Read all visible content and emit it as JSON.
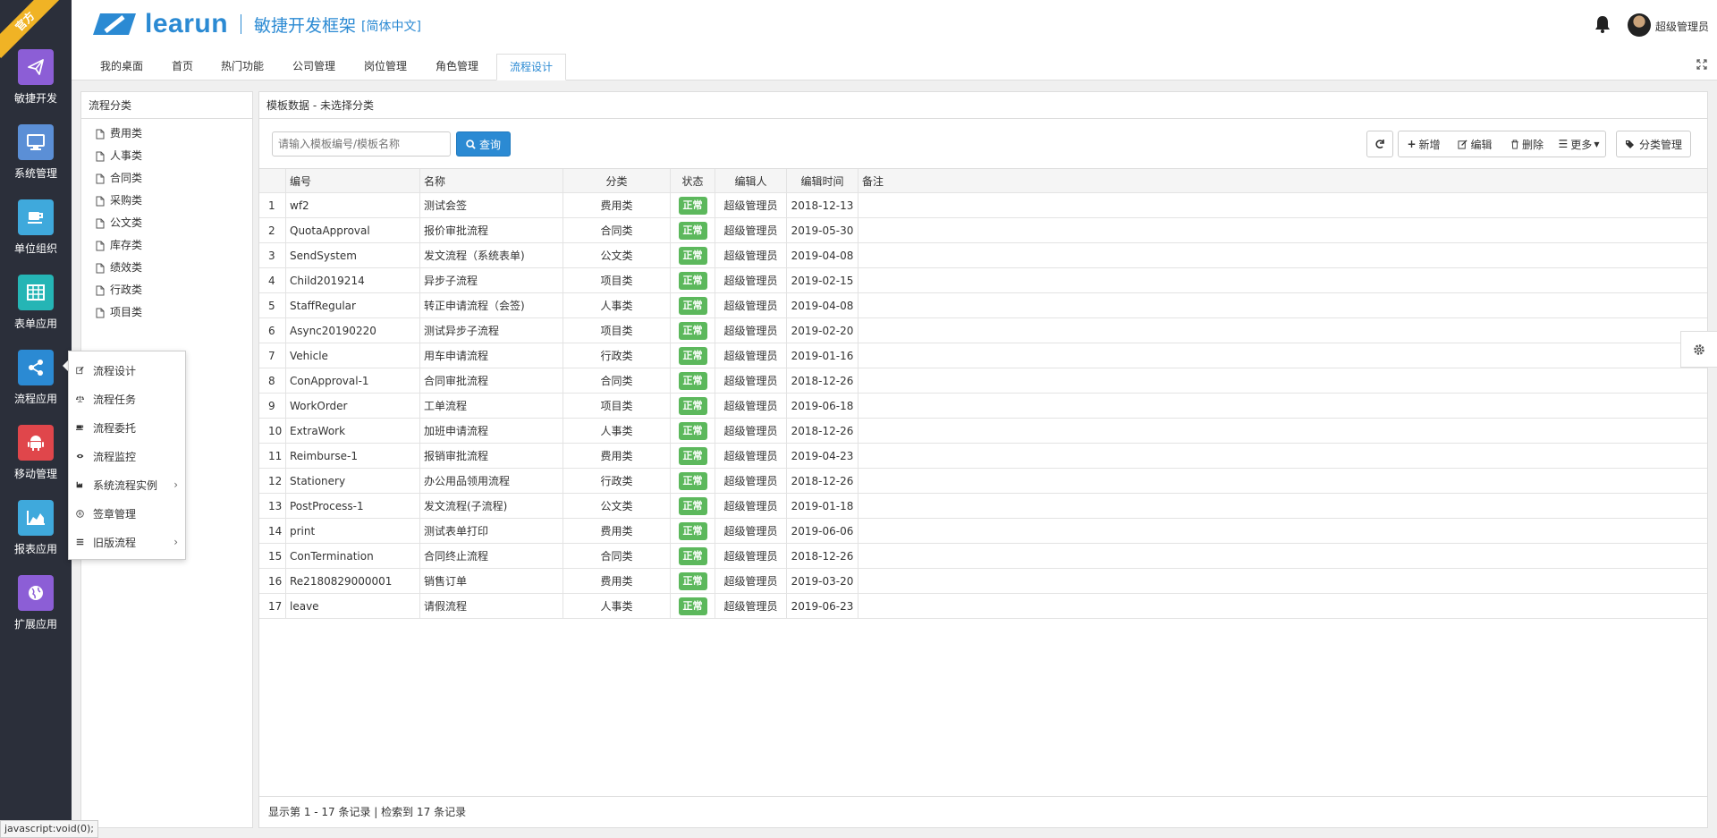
{
  "ribbon": "官方",
  "nav": [
    {
      "label": "敏捷开发",
      "color": "#8c5ed6",
      "icon": "paper-plane-icon"
    },
    {
      "label": "系统管理",
      "color": "#5b8fd6",
      "icon": "monitor-icon"
    },
    {
      "label": "单位组织",
      "color": "#3fa9dc",
      "icon": "coffee-icon"
    },
    {
      "label": "表单应用",
      "color": "#25b5b5",
      "icon": "table-icon"
    },
    {
      "label": "流程应用",
      "color": "#2b8ad3",
      "icon": "share-icon"
    },
    {
      "label": "移动管理",
      "color": "#e0464b",
      "icon": "android-icon"
    },
    {
      "label": "报表应用",
      "color": "#3fa9dc",
      "icon": "area-chart-icon"
    },
    {
      "label": "扩展应用",
      "color": "#8c5ed6",
      "icon": "globe-icon"
    }
  ],
  "header": {
    "logo": "learun",
    "subtitle": "敏捷开发框架",
    "lang": "[简体中文]",
    "username": "超级管理员"
  },
  "tabs": [
    "我的桌面",
    "首页",
    "热门功能",
    "公司管理",
    "岗位管理",
    "角色管理",
    "流程设计"
  ],
  "tree": {
    "title": "流程分类",
    "items": [
      "费用类",
      "人事类",
      "合同类",
      "采购类",
      "公文类",
      "库存类",
      "绩效类",
      "行政类",
      "项目类"
    ]
  },
  "grid": {
    "title": "模板数据 - 未选择分类",
    "search_placeholder": "请输入模板编号/模板名称",
    "search_label": "查询",
    "buttons": {
      "add": "新增",
      "edit": "编辑",
      "delete": "删除",
      "more": "更多",
      "category": "分类管理"
    },
    "columns": [
      "编号",
      "名称",
      "分类",
      "状态",
      "编辑人",
      "编辑时间",
      "备注"
    ],
    "rows": [
      {
        "n": "1",
        "code": "wf2",
        "name": "测试会签",
        "cat": "费用类",
        "status": "正常",
        "editor": "超级管理员",
        "time": "2018-12-13"
      },
      {
        "n": "2",
        "code": "QuotaApproval",
        "name": "报价审批流程",
        "cat": "合同类",
        "status": "正常",
        "editor": "超级管理员",
        "time": "2019-05-30"
      },
      {
        "n": "3",
        "code": "SendSystem",
        "name": "发文流程（系统表单)",
        "cat": "公文类",
        "status": "正常",
        "editor": "超级管理员",
        "time": "2019-04-08"
      },
      {
        "n": "4",
        "code": "Child2019214",
        "name": "异步子流程",
        "cat": "项目类",
        "status": "正常",
        "editor": "超级管理员",
        "time": "2019-02-15"
      },
      {
        "n": "5",
        "code": "StaffRegular",
        "name": "转正申请流程（会签)",
        "cat": "人事类",
        "status": "正常",
        "editor": "超级管理员",
        "time": "2019-04-08"
      },
      {
        "n": "6",
        "code": "Async20190220",
        "name": "测试异步子流程",
        "cat": "项目类",
        "status": "正常",
        "editor": "超级管理员",
        "time": "2019-02-20"
      },
      {
        "n": "7",
        "code": "Vehicle",
        "name": "用车申请流程",
        "cat": "行政类",
        "status": "正常",
        "editor": "超级管理员",
        "time": "2019-01-16"
      },
      {
        "n": "8",
        "code": "ConApproval-1",
        "name": "合同审批流程",
        "cat": "合同类",
        "status": "正常",
        "editor": "超级管理员",
        "time": "2018-12-26"
      },
      {
        "n": "9",
        "code": "WorkOrder",
        "name": "工单流程",
        "cat": "项目类",
        "status": "正常",
        "editor": "超级管理员",
        "time": "2019-06-18"
      },
      {
        "n": "10",
        "code": "ExtraWork",
        "name": "加班申请流程",
        "cat": "人事类",
        "status": "正常",
        "editor": "超级管理员",
        "time": "2018-12-26"
      },
      {
        "n": "11",
        "code": "Reimburse-1",
        "name": "报销审批流程",
        "cat": "费用类",
        "status": "正常",
        "editor": "超级管理员",
        "time": "2019-04-23"
      },
      {
        "n": "12",
        "code": "Stationery",
        "name": "办公用品领用流程",
        "cat": "行政类",
        "status": "正常",
        "editor": "超级管理员",
        "time": "2018-12-26"
      },
      {
        "n": "13",
        "code": "PostProcess-1",
        "name": "发文流程(子流程)",
        "cat": "公文类",
        "status": "正常",
        "editor": "超级管理员",
        "time": "2019-01-18"
      },
      {
        "n": "14",
        "code": "print",
        "name": "测试表单打印",
        "cat": "费用类",
        "status": "正常",
        "editor": "超级管理员",
        "time": "2019-06-06"
      },
      {
        "n": "15",
        "code": "ConTermination",
        "name": "合同终止流程",
        "cat": "合同类",
        "status": "正常",
        "editor": "超级管理员",
        "time": "2018-12-26"
      },
      {
        "n": "16",
        "code": "Re2180829000001",
        "name": "销售订单",
        "cat": "费用类",
        "status": "正常",
        "editor": "超级管理员",
        "time": "2019-03-20"
      },
      {
        "n": "17",
        "code": "leave",
        "name": "请假流程",
        "cat": "人事类",
        "status": "正常",
        "editor": "超级管理员",
        "time": "2019-06-23"
      }
    ],
    "pager": "显示第 1 - 17 条记录 | 检索到 17 条记录"
  },
  "flyout": {
    "items": [
      {
        "label": "流程设计",
        "icon": "edit-icon",
        "sub": false
      },
      {
        "label": "流程任务",
        "icon": "balance-scale-icon",
        "sub": false
      },
      {
        "label": "流程委托",
        "icon": "coffee-cup-icon",
        "sub": false
      },
      {
        "label": "流程监控",
        "icon": "eye-icon",
        "sub": false
      },
      {
        "label": "系统流程实例",
        "icon": "industry-icon",
        "sub": true
      },
      {
        "label": "签章管理",
        "icon": "registered-icon",
        "sub": false
      },
      {
        "label": "旧版流程",
        "icon": "list-icon",
        "sub": true
      }
    ],
    "sub_arrow": "›"
  },
  "status_bar": "javascript:void(0);"
}
